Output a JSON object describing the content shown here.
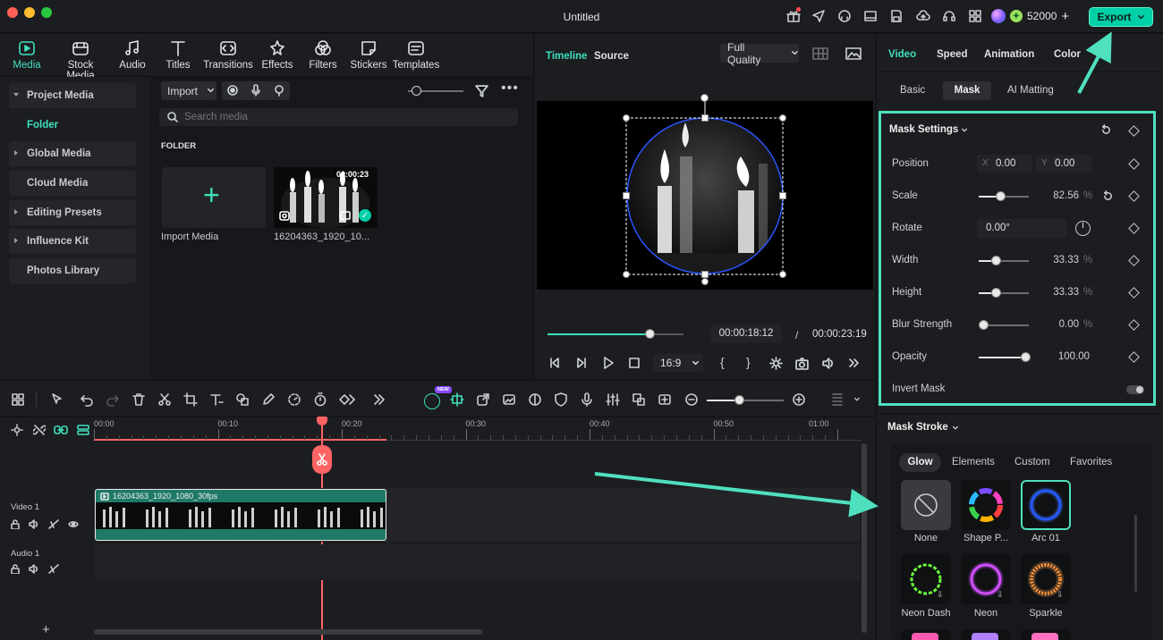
{
  "window": {
    "title": "Untitled"
  },
  "topbar": {
    "credits": "52000",
    "export_label": "Export"
  },
  "media_tabs": [
    {
      "label": "Media",
      "icon": "media-icon",
      "active": true
    },
    {
      "label": "Stock Media",
      "icon": "stock-media-icon"
    },
    {
      "label": "Audio",
      "icon": "music-note-icon"
    },
    {
      "label": "Titles",
      "icon": "text-t-icon"
    },
    {
      "label": "Transitions",
      "icon": "transitions-icon"
    },
    {
      "label": "Effects",
      "icon": "effects-icon"
    },
    {
      "label": "Filters",
      "icon": "filters-icon"
    },
    {
      "label": "Stickers",
      "icon": "stickers-icon"
    },
    {
      "label": "Templates",
      "icon": "templates-icon"
    }
  ],
  "nav": {
    "project_media": "Project Media",
    "folder": "Folder",
    "global_media": "Global Media",
    "cloud_media": "Cloud Media",
    "editing_presets": "Editing Presets",
    "influence_kit": "Influence Kit",
    "photos_library": "Photos Library"
  },
  "media_toolbar": {
    "import_label": "Import",
    "search_placeholder": "Search media"
  },
  "media_grid": {
    "section_label": "FOLDER",
    "import_tile_label": "Import Media",
    "clip_name": "16204363_1920_10...",
    "clip_duration": "00:00:23"
  },
  "player": {
    "tabs": [
      "Timeline",
      "Source"
    ],
    "quality": "Full Quality",
    "current_time": "00:00:18:12",
    "separator": "/",
    "total_time": "00:00:23:19",
    "aspect_ratio": "16:9",
    "progress": 0.75
  },
  "props": {
    "top_tabs": [
      "Video",
      "Speed",
      "Animation",
      "Color"
    ],
    "sub_tabs": [
      "Basic",
      "Mask",
      "AI Matting"
    ],
    "mask_settings_title": "Mask Settings",
    "position_label": "Position",
    "position_x_label": "X",
    "position_x": "0.00",
    "position_y_label": "Y",
    "position_y": "0.00",
    "scale_label": "Scale",
    "scale_value": "82.56",
    "scale_unit": "%",
    "rotate_label": "Rotate",
    "rotate_value": "0.00°",
    "width_label": "Width",
    "width_value": "33.33",
    "width_unit": "%",
    "height_label": "Height",
    "height_value": "33.33",
    "height_unit": "%",
    "blur_label": "Blur Strength",
    "blur_value": "0.00",
    "blur_unit": "%",
    "opacity_label": "Opacity",
    "opacity_value": "100.00",
    "invert_label": "Invert Mask",
    "mask_stroke_title": "Mask Stroke",
    "stroke_tabs": [
      "Glow",
      "Elements",
      "Custom",
      "Favorites"
    ],
    "stroke_items": [
      "None",
      "Shape P...",
      "Arc 01",
      "Neon Dash",
      "Neon",
      "Sparkle"
    ]
  },
  "timeline": {
    "ticks": [
      "00:00",
      "00:10",
      "00:20",
      "00:30",
      "00:40",
      "00:50",
      "01:00"
    ],
    "video_track_label": "Video 1",
    "audio_track_label": "Audio 1",
    "clip_label": "16204363_1920_1080_30fps",
    "new_badge": "NEW",
    "add_track": "+"
  },
  "colors": {
    "accent": "#00d0a8",
    "annotation": "#4fe0bf",
    "playhead": "#ff6464"
  }
}
